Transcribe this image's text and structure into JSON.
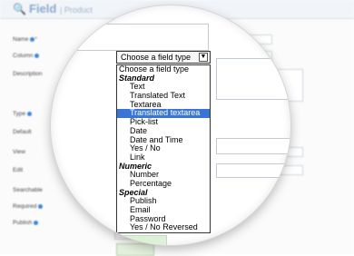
{
  "header": {
    "title": "Field",
    "subtitle": "| Product"
  },
  "form": {
    "labels": [
      "Name",
      "Column",
      "Description",
      "Type",
      "Default",
      "View",
      "Edit",
      "Searchable",
      "Required",
      "Publish"
    ]
  },
  "type_select": {
    "value": "Choose a field type",
    "options": [
      {
        "label": "Choose a field type",
        "kind": "placeholder"
      },
      {
        "label": "Standard",
        "kind": "group"
      },
      {
        "label": "Text",
        "kind": "item"
      },
      {
        "label": "Translated Text",
        "kind": "item"
      },
      {
        "label": "Textarea",
        "kind": "item"
      },
      {
        "label": "Translated textarea",
        "kind": "item",
        "selected": true
      },
      {
        "label": "Pick-list",
        "kind": "item"
      },
      {
        "label": "Date",
        "kind": "item"
      },
      {
        "label": "Date and Time",
        "kind": "item"
      },
      {
        "label": "Yes / No",
        "kind": "item"
      },
      {
        "label": "Link",
        "kind": "item"
      },
      {
        "label": "Numeric",
        "kind": "group"
      },
      {
        "label": "Number",
        "kind": "item"
      },
      {
        "label": "Percentage",
        "kind": "item"
      },
      {
        "label": "Special",
        "kind": "group"
      },
      {
        "label": "Publish",
        "kind": "item"
      },
      {
        "label": "Email",
        "kind": "item"
      },
      {
        "label": "Password",
        "kind": "item"
      },
      {
        "label": "Yes / No Reversed",
        "kind": "item"
      }
    ]
  },
  "colors": {
    "highlight": "#3875d7",
    "header_text": "#8aa8cf",
    "info_dot": "#3f86d6"
  }
}
